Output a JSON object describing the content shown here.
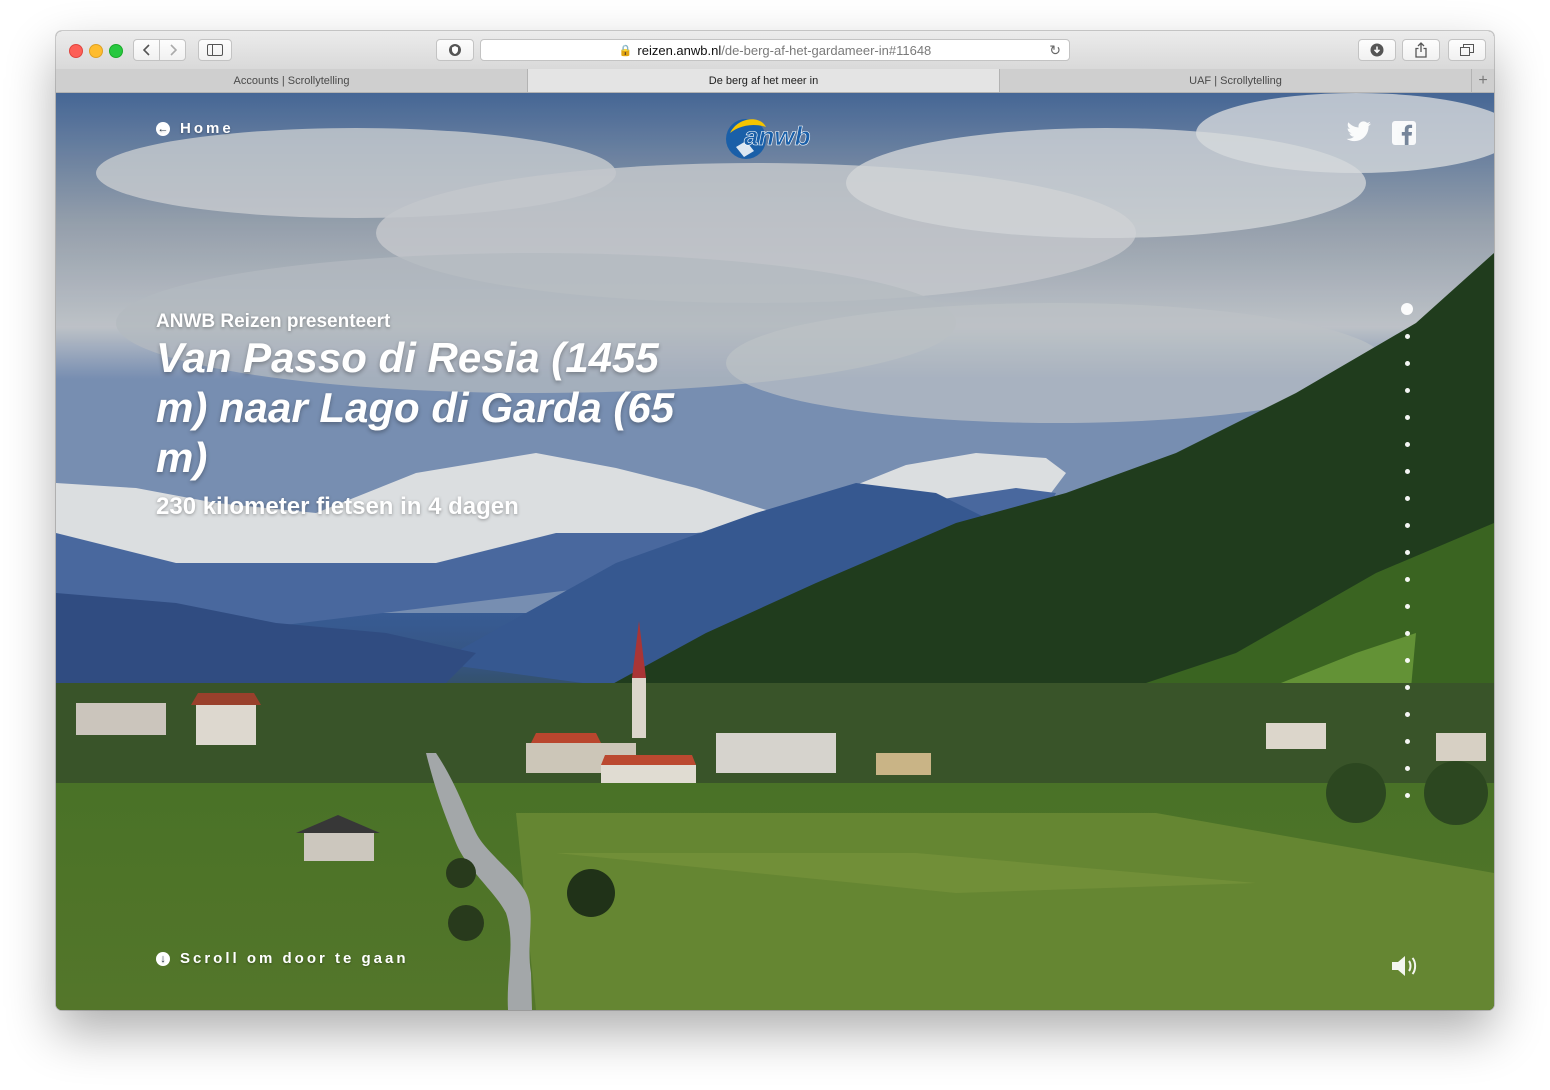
{
  "browser": {
    "url_host": "reizen.anwb.nl",
    "url_path": "/de-berg-af-het-gardameer-in#11648",
    "tabs": [
      {
        "label": "Accounts | Scrollytelling",
        "active": false
      },
      {
        "label": "De berg af het meer in",
        "active": true
      },
      {
        "label": "UAF | Scrollytelling",
        "active": false
      }
    ]
  },
  "header": {
    "home_label": "Home",
    "logo_text": "anwb"
  },
  "hero": {
    "kicker": "ANWB Reizen presenteert",
    "title": "Van Passo di Resia (1455 m) naar Lago di Garda (65 m)",
    "subtitle": "230 kilometer fietsen in 4 dagen"
  },
  "footer": {
    "scroll_label": "Scroll om door te gaan"
  },
  "progress_nav": {
    "total_sections": 19,
    "active_index": 0
  },
  "colors": {
    "brand_blue": "#1a5fa8",
    "brand_yellow": "#f5c400"
  }
}
